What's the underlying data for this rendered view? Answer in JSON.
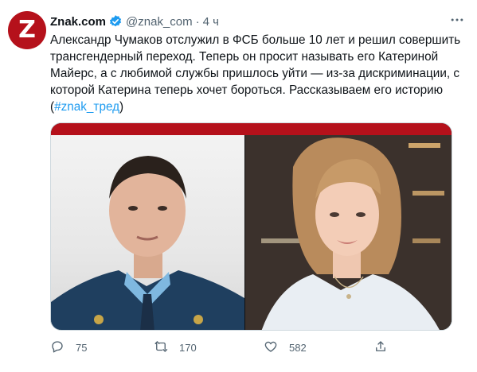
{
  "tweet": {
    "avatar_letter": "Z",
    "author_name": "Znak.com",
    "handle": "@znak_com",
    "separator": "·",
    "time": "4 ч",
    "text_main": "Александр Чумаков отслужил в ФСБ больше 10 лет и решил совершить трансгендерный переход. Теперь он просит называть его Катериной Майерс, а с любимой службы пришлось уйти — из-за дискриминации, с которой Катерина теперь хочет бороться. Рассказываем его историю (",
    "hashtag": "#znak_тред",
    "text_end": ")",
    "replies": "75",
    "retweets": "170",
    "likes": "582"
  },
  "colors": {
    "accent": "#1d9bf0",
    "brand": "#b5111b",
    "muted": "#536471"
  },
  "icons": [
    "verified-badge-icon",
    "more-icon",
    "reply-icon",
    "retweet-icon",
    "like-icon",
    "share-icon"
  ]
}
